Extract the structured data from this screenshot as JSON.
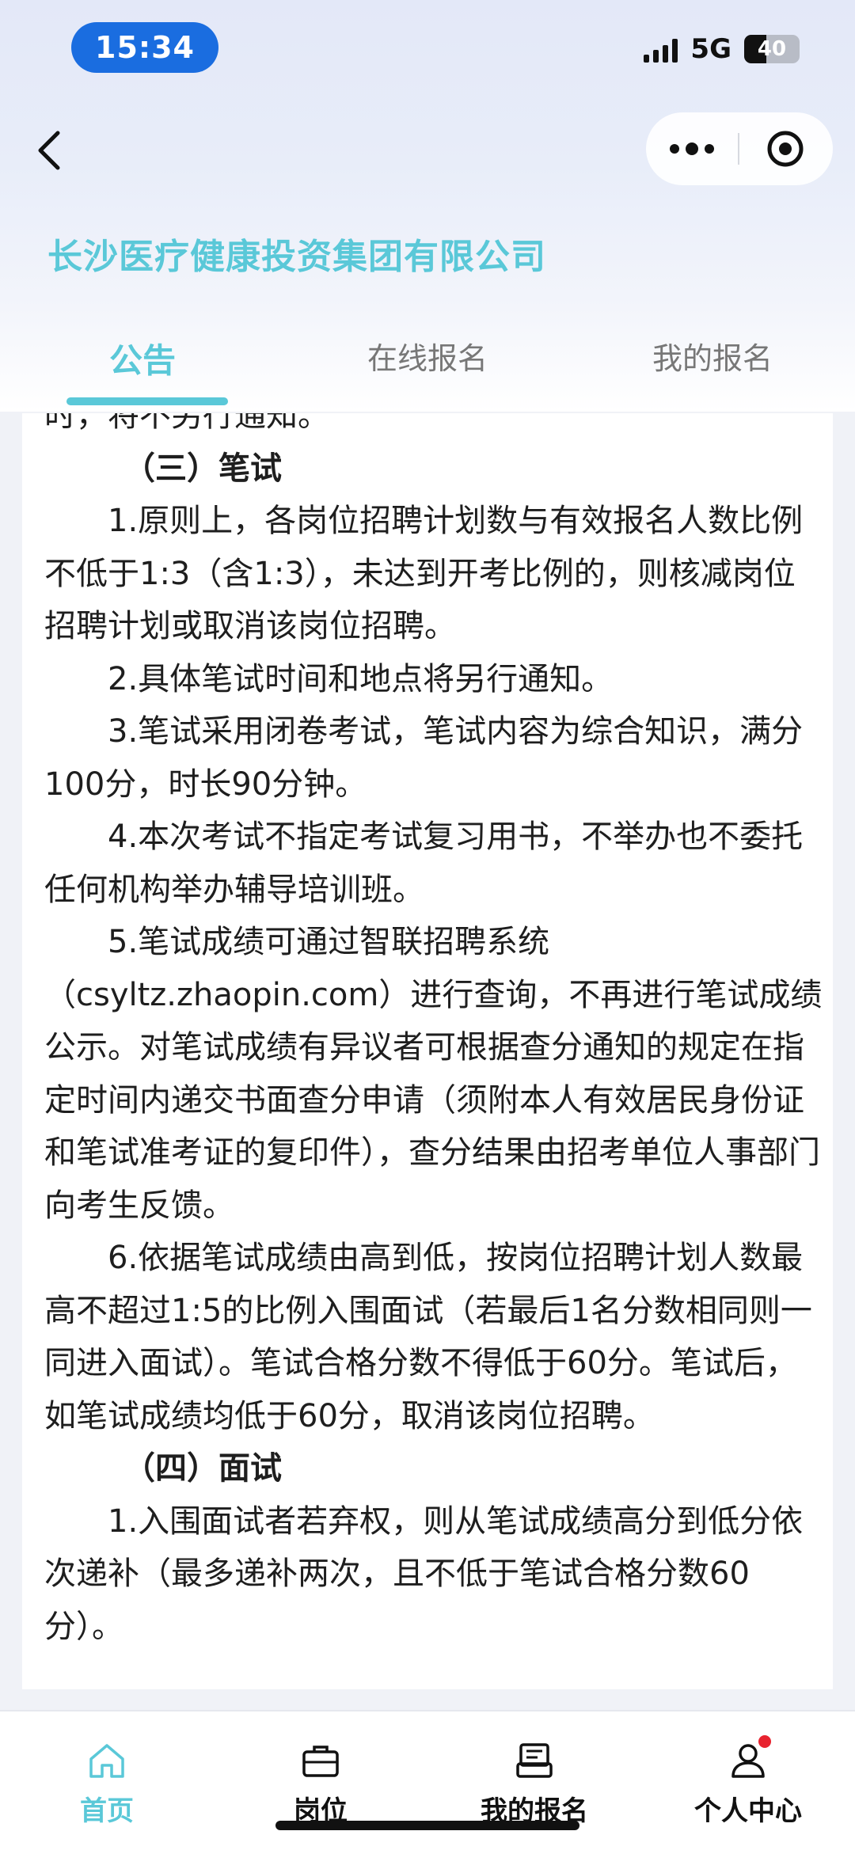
{
  "status_bar": {
    "time": "15:34",
    "network": "5G",
    "battery": "40"
  },
  "header": {
    "company_name": "长沙医疗健康投资集团有限公司"
  },
  "tabs": [
    {
      "label": "公告",
      "active": true
    },
    {
      "label": "在线报名",
      "active": false
    },
    {
      "label": "我的报名",
      "active": false
    }
  ],
  "content": {
    "partial_top_line": "时，将不另行通知。",
    "section3_title": "（三）笔试",
    "p1": "1.原则上，各岗位招聘计划数与有效报名人数比例不低于1:3（含1:3），未达到开考比例的，则核减岗位招聘计划或取消该岗位招聘。",
    "p2": "2.具体笔试时间和地点将另行通知。",
    "p3": "3.笔试采用闭卷考试，笔试内容为综合知识，满分100分，时长90分钟。",
    "p4": "4.本次考试不指定考试复习用书，不举办也不委托任何机构举办辅导培训班。",
    "p5_a": "5.笔试成绩可通过智联招聘系统",
    "p5_b": "（csyltz.zhaopin.com）进行查询，不再进行笔试成绩公示。对笔试成绩有异议者可根据查分通知的规定在指定时间内递交书面查分申请（须附本人有效居民身份证和笔试准考证的复印件），查分结果由招考单位人事部门向考生反馈。",
    "p6": "6.依据笔试成绩由高到低，按岗位招聘计划人数最高不超过1:5的比例入围面试（若最后1名分数相同则一同进入面试）。笔试合格分数不得低于60分。笔试后，如笔试成绩均低于60分，取消该岗位招聘。",
    "section4_title": "（四）面试",
    "p7": "1.入围面试者若弃权，则从笔试成绩高分到低分依次递补（最多递补两次，且不低于笔试合格分数60分）。"
  },
  "bottom_nav": [
    {
      "label": "首页",
      "icon": "home-icon",
      "active": true
    },
    {
      "label": "岗位",
      "icon": "briefcase-icon",
      "active": false
    },
    {
      "label": "我的报名",
      "icon": "registration-icon",
      "active": false
    },
    {
      "label": "个人中心",
      "icon": "user-icon",
      "active": false,
      "badge": true
    }
  ],
  "colors": {
    "accent": "#5ac8d8",
    "time_pill": "#1a6de0",
    "badge": "#e8232f"
  }
}
